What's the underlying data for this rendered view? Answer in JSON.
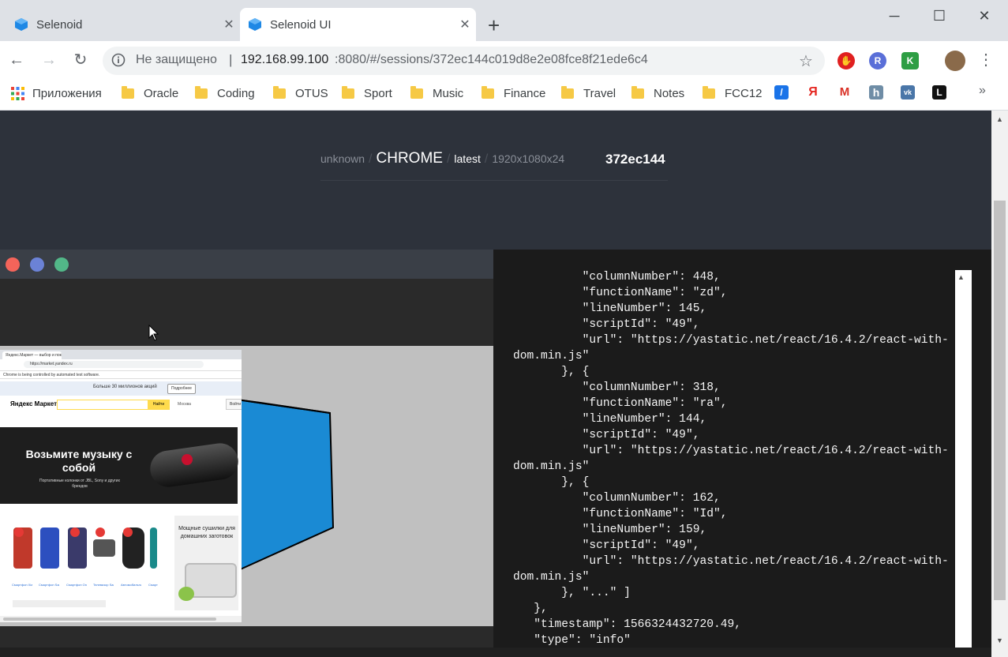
{
  "browser": {
    "tabs": [
      {
        "title": "Selenoid",
        "active": false,
        "close": "✕"
      },
      {
        "title": "Selenoid UI",
        "active": true,
        "close": "✕"
      }
    ],
    "new_tab": "+",
    "window_controls": {
      "minimize": "─",
      "maximize": "☐",
      "close": "✕"
    },
    "nav": {
      "back": "←",
      "forward": "→",
      "reload": "↻"
    },
    "address": {
      "security_text": "Не защищено",
      "separator": "|",
      "host": "192.168.99.100",
      "rest": ":8080/#/sessions/372ec144c019d8e2e08fce8f21ede6c4"
    },
    "star": "☆",
    "extensions": [
      {
        "name": "adblock-icon",
        "label": "✋",
        "color": "#e02020"
      },
      {
        "name": "r-extension-icon",
        "label": "R",
        "color": "#5a6fd8"
      },
      {
        "name": "k-extension-icon",
        "label": "K",
        "color": "#2e9e44"
      },
      {
        "name": "profile-avatar",
        "label": "",
        "color": "#8a6a4a"
      }
    ],
    "menu": "⋮",
    "bookmarks": {
      "apps_label": "Приложения",
      "folders": [
        "Oracle",
        "Coding",
        "OTUS",
        "Sport",
        "Music",
        "Finance",
        "Travel",
        "Notes",
        "FCC12"
      ],
      "icons": [
        {
          "name": "slash-bookmark-icon",
          "label": "/",
          "color": "#1a73e8"
        },
        {
          "name": "yandex-bookmark-icon",
          "label": "Я",
          "color": "#ffffff",
          "text_color": "#e52620"
        },
        {
          "name": "gmail-bookmark-icon",
          "label": "M",
          "color": "#ffffff",
          "text_color": "#d93025"
        },
        {
          "name": "habr-bookmark-icon",
          "label": "h",
          "color": "#6f8da6"
        },
        {
          "name": "vk-bookmark-icon",
          "label": "vk",
          "color": "#4a76a8"
        },
        {
          "name": "l-bookmark-icon",
          "label": "L",
          "color": "#111111"
        }
      ],
      "overflow": "»"
    }
  },
  "session": {
    "os": "unknown",
    "browser": "CHROME",
    "version": "latest",
    "resolution": "1920x1080x24",
    "separator": "/",
    "id": "372ec144"
  },
  "vnc": {
    "dots": [
      {
        "name": "close-dot",
        "color": "#f4645a"
      },
      {
        "name": "minimize-dot",
        "color": "#6b82d6"
      },
      {
        "name": "maximize-dot",
        "color": "#52b788"
      }
    ]
  },
  "log": {
    "lines": [
      "          \"columnNumber\": 448,",
      "          \"functionName\": \"zd\",",
      "          \"lineNumber\": 145,",
      "          \"scriptId\": \"49\",",
      "          \"url\": \"https://yastatic.net/react/16.4.2/react-with-",
      "dom.min.js\"",
      "       }, {",
      "          \"columnNumber\": 318,",
      "          \"functionName\": \"ra\",",
      "          \"lineNumber\": 144,",
      "          \"scriptId\": \"49\",",
      "          \"url\": \"https://yastatic.net/react/16.4.2/react-with-",
      "dom.min.js\"",
      "       }, {",
      "          \"columnNumber\": 162,",
      "          \"functionName\": \"Id\",",
      "          \"lineNumber\": 159,",
      "          \"scriptId\": \"49\",",
      "          \"url\": \"https://yastatic.net/react/16.4.2/react-with-",
      "dom.min.js\"",
      "       }, \"...\" ]",
      "   },",
      "   \"timestamp\": 1566324432720.49,",
      "   \"type\": \"info\""
    ]
  },
  "mini_browser": {
    "tab_title": "Яндекс.Маркет — выбор и покупка",
    "url": "https://market.yandex.ru",
    "automation_notice": "Chrome is being controlled by automated test software.",
    "promo_text": "Больше 30 миллионов акций",
    "promo_button": "Подробнее",
    "logo": "Яндекс Маркет",
    "search_button": "Найти",
    "region": "Москва",
    "login": "Войти",
    "banner_title": "Возьмите музыку с собой",
    "banner_sub": "Портативные колонки от JBL, Sony и других брендов",
    "ad_text": "Мощные сушилки для домашних заготовок",
    "products": [
      {
        "color": "#c0392b",
        "price": "Смартфон Xiaomi"
      },
      {
        "color": "#2c4fbf",
        "price": "Смартфон Samsung"
      },
      {
        "color": "#3a3a6a",
        "price": "Смартфон OnePlus"
      },
      {
        "color": "#555555",
        "price": "Телевизор Samsung"
      },
      {
        "color": "#222222",
        "price": "Автомобильная шина"
      },
      {
        "color": "#1a8a8a",
        "price": "Смартфон"
      }
    ]
  }
}
